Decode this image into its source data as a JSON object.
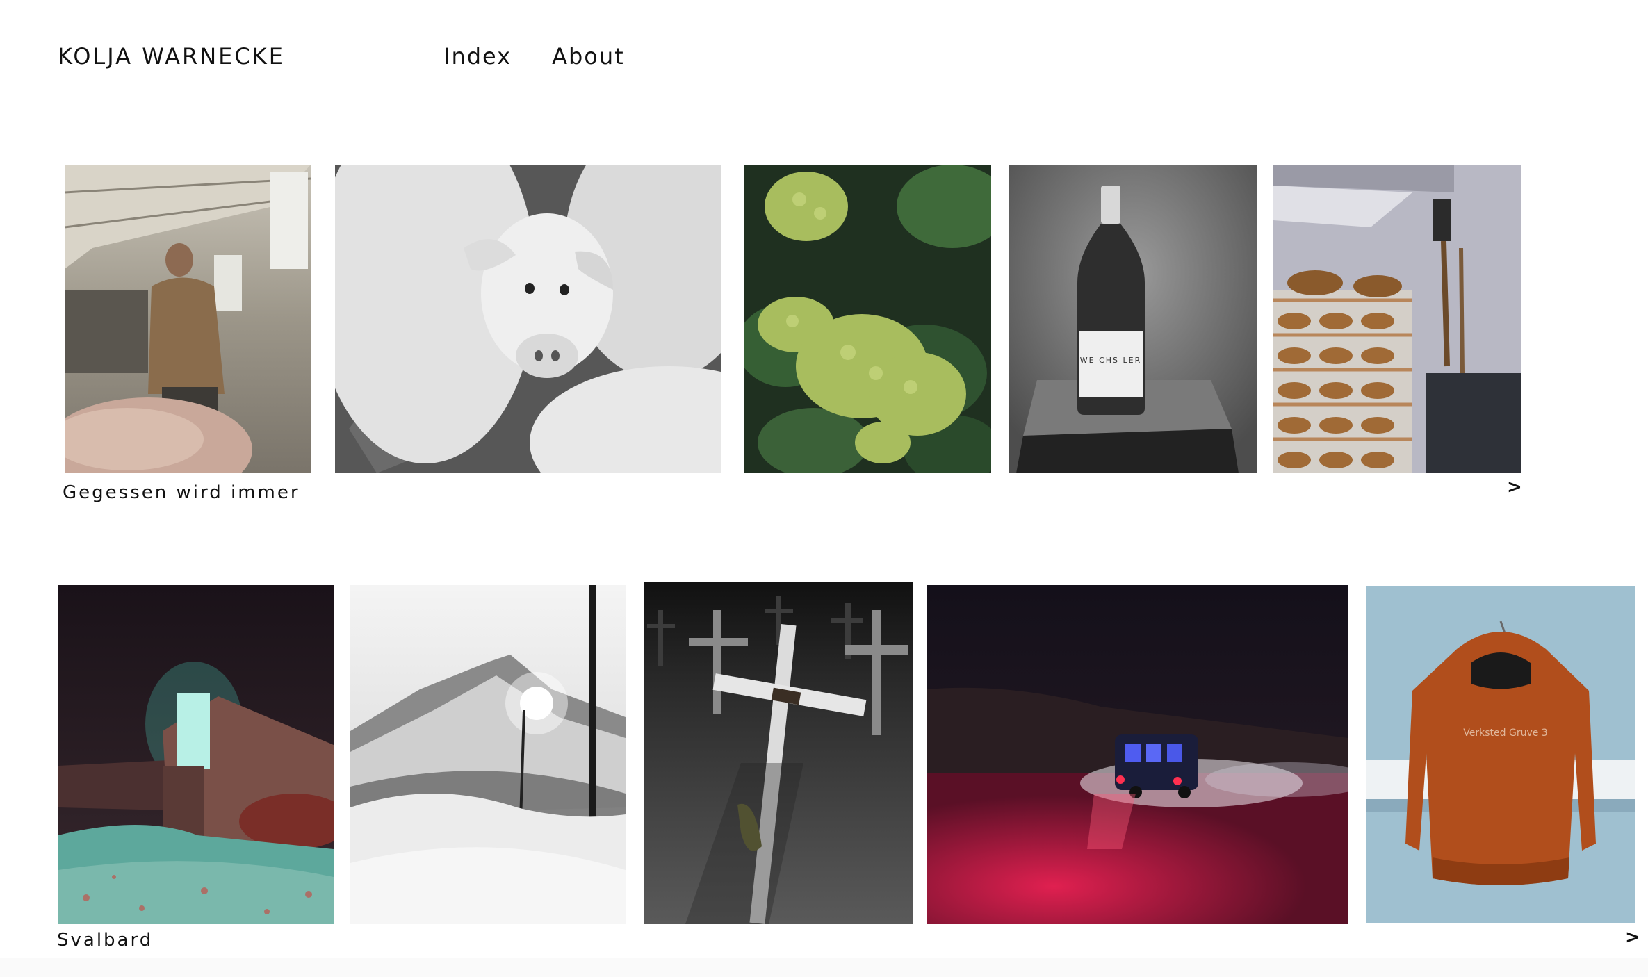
{
  "header": {
    "site_title": "KOLJA WARNECKE",
    "nav": [
      {
        "label": "Index"
      },
      {
        "label": "About"
      }
    ]
  },
  "galleries": [
    {
      "title": "Gegessen wird immer",
      "next_label": ">",
      "images": [
        {
          "subject": "farmer-with-pig"
        },
        {
          "subject": "pigs-black-and-white"
        },
        {
          "subject": "grapes-on-vine"
        },
        {
          "subject": "wine-bottle-on-stone",
          "label_text": "WE CHS LER"
        },
        {
          "subject": "bread-shelves-bakery"
        }
      ]
    },
    {
      "title": "Svalbard",
      "next_label": ">",
      "images": [
        {
          "subject": "seed-vault-at-night"
        },
        {
          "subject": "snowy-mountain-streetlight"
        },
        {
          "subject": "grave-crosses-in-snow"
        },
        {
          "subject": "van-in-red-light"
        },
        {
          "subject": "orange-jacket-on-hanger",
          "label_text": "Verksted Gruve 3"
        }
      ]
    }
  ]
}
